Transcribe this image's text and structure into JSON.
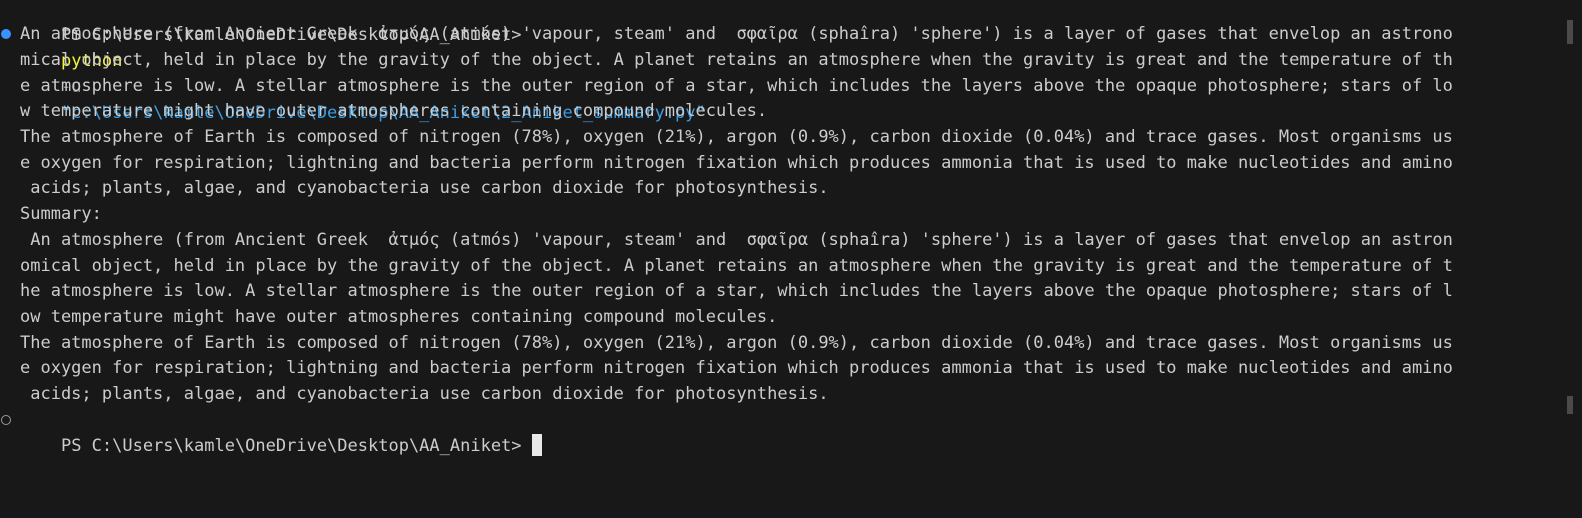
{
  "terminal": {
    "prompt_lines": [
      {
        "prompt": "PS C:\\Users\\kamle\\OneDrive\\Desktop\\AA_Aniket>",
        "exe": "python",
        "flag": "-u",
        "arg": "\"c:\\Users\\kamle\\OneDrive\\Desktop\\AA_Aniket\\2_Aniket_summary.py\""
      }
    ],
    "output_lines": [
      "An atmosphere (from Ancient Greek  ἀτμός (atmós) 'vapour, steam' and  σφαῖρα (sphaîra) 'sphere') is a layer of gases that envelop an astrono",
      "mical object, held in place by the gravity of the object. A planet retains an atmosphere when the gravity is great and the temperature of th",
      "e atmosphere is low. A stellar atmosphere is the outer region of a star, which includes the layers above the opaque photosphere; stars of lo",
      "w temperature might have outer atmospheres containing compound molecules.",
      "The atmosphere of Earth is composed of nitrogen (78%), oxygen (21%), argon (0.9%), carbon dioxide (0.04%) and trace gases. Most organisms us",
      "e oxygen for respiration; lightning and bacteria perform nitrogen fixation which produces ammonia that is used to make nucleotides and amino",
      " acids; plants, algae, and cyanobacteria use carbon dioxide for photosynthesis.",
      "Summary:",
      " An atmosphere (from Ancient Greek  ἀτμός (atmós) 'vapour, steam' and  σφαῖρα (sphaîra) 'sphere') is a layer of gases that envelop an astron",
      "omical object, held in place by the gravity of the object. A planet retains an atmosphere when the gravity is great and the temperature of t",
      "he atmosphere is low. A stellar atmosphere is the outer region of a star, which includes the layers above the opaque photosphere; stars of l",
      "ow temperature might have outer atmospheres containing compound molecules.",
      "The atmosphere of Earth is composed of nitrogen (78%), oxygen (21%), argon (0.9%), carbon dioxide (0.04%) and trace gases. Most organisms us",
      "e oxygen for respiration; lightning and bacteria perform nitrogen fixation which produces ammonia that is used to make nucleotides and amino",
      " acids; plants, algae, and cyanobacteria use carbon dioxide for photosynthesis."
    ],
    "final_prompt": "PS C:\\Users\\kamle\\OneDrive\\Desktop\\AA_Aniket>",
    "colors": {
      "background": "#181818",
      "text": "#cccccc",
      "command_exe": "#f5f543",
      "command_flag": "#8c8c8c",
      "command_arg": "#3b9de2",
      "decoration_running": "#3794ff"
    }
  }
}
